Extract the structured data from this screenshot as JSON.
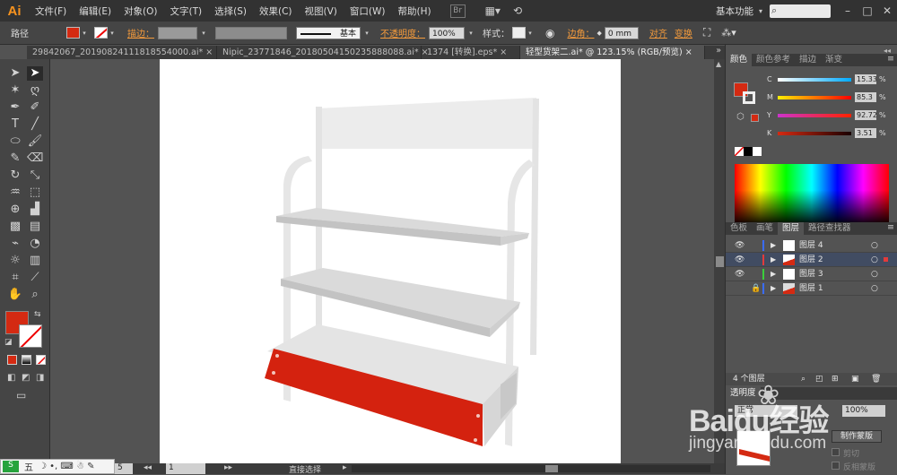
{
  "app": {
    "logo": "Ai",
    "workspace": "基本功能",
    "menus": [
      "文件(F)",
      "编辑(E)",
      "对象(O)",
      "文字(T)",
      "选择(S)",
      "效果(C)",
      "视图(V)",
      "窗口(W)",
      "帮助(H)"
    ],
    "bridge": "Br"
  },
  "control": {
    "selection_label": "路径",
    "stroke_label": "描边：",
    "stroke_profile": "基本",
    "opacity_label": "不透明度：",
    "opacity_value": "100%",
    "style_label": "样式：",
    "corner_label": "边角：",
    "corner_value": "0 mm",
    "align_label": "对齐",
    "transform_label": "变换",
    "fill_color": "#d42a12"
  },
  "tabs": [
    {
      "label": "29842067_2019082411181855400​0.ai*",
      "close": "×"
    },
    {
      "label": "Nipic_23771846_20180504150235888088.ai*",
      "close": "×"
    },
    {
      "label": "1374 [转换].eps*",
      "close": "×"
    },
    {
      "label": "轻型货架二.ai* @ 123.15% (RGB/预览)",
      "close": "×"
    }
  ],
  "color_panel": {
    "tabs": [
      "颜色",
      "颜色参考",
      "描边",
      "渐变"
    ],
    "channels": [
      {
        "name": "C",
        "value": "15.33"
      },
      {
        "name": "M",
        "value": "85.3"
      },
      {
        "name": "Y",
        "value": "92.72"
      },
      {
        "name": "K",
        "value": "3.51"
      }
    ],
    "unit": "%"
  },
  "layers_panel": {
    "tabs": [
      "色板",
      "画笔",
      "图层",
      "路径查找器"
    ],
    "layers": [
      {
        "name": "图层 4",
        "color": "#3a6cff",
        "visible": true,
        "locked": false
      },
      {
        "name": "图层 2",
        "color": "#e23b3b",
        "visible": true,
        "locked": false,
        "selected": true
      },
      {
        "name": "图层 3",
        "color": "#3bcf3b",
        "visible": true,
        "locked": false
      },
      {
        "name": "图层 1",
        "color": "#3a6cff",
        "visible": false,
        "locked": true
      }
    ],
    "count": "4 个图层"
  },
  "transparency_panel": {
    "tab": "透明度",
    "mode": "正常",
    "opacity": "100%",
    "make_mask": "制作蒙版",
    "clip": "剪切",
    "invert": "反相蒙版"
  },
  "status": {
    "zoom": "5",
    "page": "1",
    "tool": "直接选择"
  },
  "canvas": {
    "colors": {
      "frame": "#e0e0e0",
      "shelf_top": "#d6d6d6",
      "shelf_front": "#bcbcbc",
      "front_panel": "#d4220f",
      "board": "#ececec"
    }
  },
  "watermark": {
    "brand": "Baidu经验",
    "url": "jingyan.baidu.com"
  },
  "ime": {
    "label": "五"
  }
}
